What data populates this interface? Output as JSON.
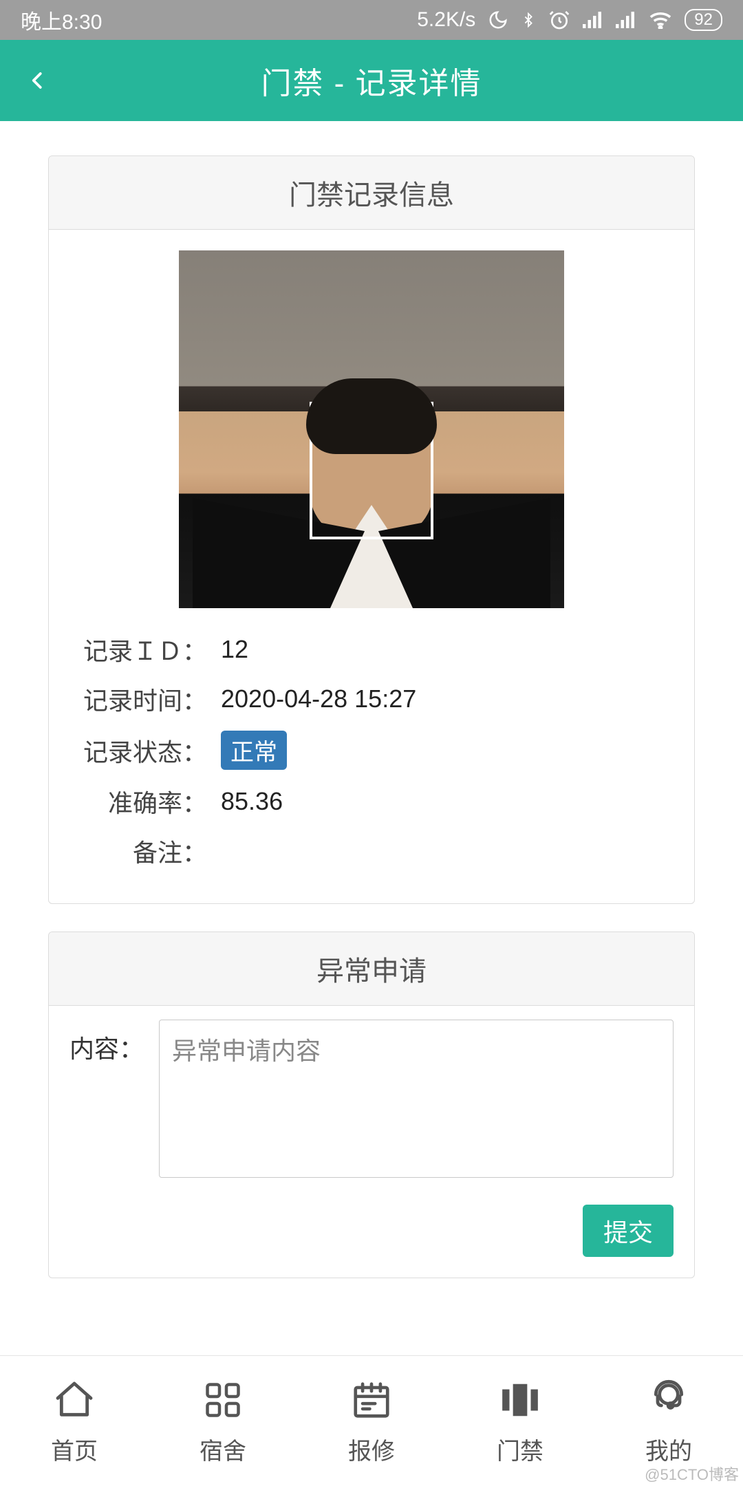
{
  "status_bar": {
    "time": "晚上8:30",
    "net_speed": "5.2K/s",
    "battery": "92"
  },
  "header": {
    "title": "门禁 - 记录详情"
  },
  "record_panel": {
    "title": "门禁记录信息",
    "fields": {
      "id_label": "记录ＩＤ：",
      "id_value": "12",
      "time_label": "记录时间：",
      "time_value": "2020-04-28 15:27",
      "status_label": "记录状态：",
      "status_value": "正常",
      "accuracy_label": "准确率：",
      "accuracy_value": "85.36",
      "remark_label": "备注：",
      "remark_value": ""
    }
  },
  "exception_panel": {
    "title": "异常申请",
    "content_label": "内容：",
    "content_placeholder": "异常申请内容",
    "submit_label": "提交"
  },
  "bottom_nav": {
    "items": [
      {
        "label": "首页",
        "icon": "home-icon"
      },
      {
        "label": "宿舍",
        "icon": "grid-icon"
      },
      {
        "label": "报修",
        "icon": "calendar-icon"
      },
      {
        "label": "门禁",
        "icon": "door-icon"
      },
      {
        "label": "我的",
        "icon": "support-icon"
      }
    ]
  },
  "watermark": "@51CTO博客",
  "colors": {
    "primary": "#26b69a",
    "badge": "#337ab7"
  }
}
